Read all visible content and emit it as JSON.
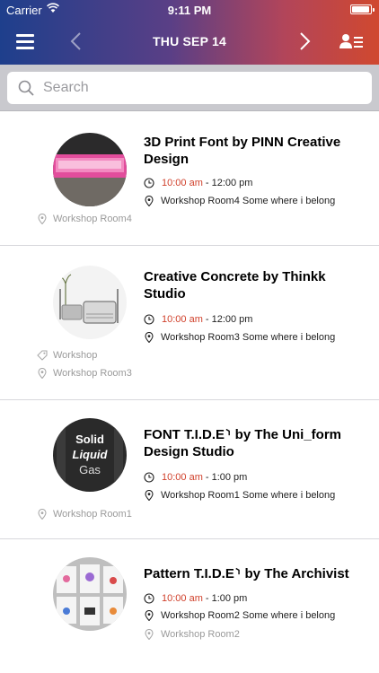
{
  "status_bar": {
    "carrier": "Carrier",
    "time": "9:11 PM",
    "battery_level": 0.95
  },
  "nav": {
    "date": "THU SEP 14"
  },
  "search": {
    "placeholder": "Search"
  },
  "colors": {
    "accent_time": "#d0402b",
    "header_left": "#1e3f8c",
    "header_right": "#d0482f"
  },
  "events": [
    {
      "title_lines": [
        "3D Print Font by PINN Creative",
        "Design"
      ],
      "start": "10:00 am",
      "end": "- 12:00 pm",
      "location": "Workshop Room4 Some where i belong",
      "tags": [
        {
          "icon": "location-pin-icon",
          "text": "Workshop Room4"
        }
      ]
    },
    {
      "title_lines": [
        "Creative Concrete by Thinkk",
        "Studio"
      ],
      "start": "10:00 am",
      "end": "- 12:00 pm",
      "location": "Workshop Room3 Some where i belong",
      "tags": [
        {
          "icon": "tag-icon",
          "text": "Workshop"
        },
        {
          "icon": "location-pin-icon",
          "text": "Workshop Room3"
        }
      ]
    },
    {
      "title_lines": [
        "FONT T.I.D.E⸃ by The Uni_form",
        "Design Studio"
      ],
      "start": "10:00 am",
      "end": "- 1:00 pm",
      "location": "Workshop Room1 Some where i belong",
      "tags": [
        {
          "icon": "location-pin-icon",
          "text": "Workshop Room1"
        }
      ],
      "thumb_words": [
        "Solid",
        "Liquid",
        "Gas"
      ]
    },
    {
      "title_lines": [
        "Pattern T.I.D.E⸃ by The Archivist"
      ],
      "start": "10:00 am",
      "end": "- 1:00 pm",
      "location": "Workshop Room2 Some where i belong",
      "tags": [
        {
          "icon": "location-pin-icon",
          "text": "Workshop Room2"
        }
      ]
    }
  ]
}
